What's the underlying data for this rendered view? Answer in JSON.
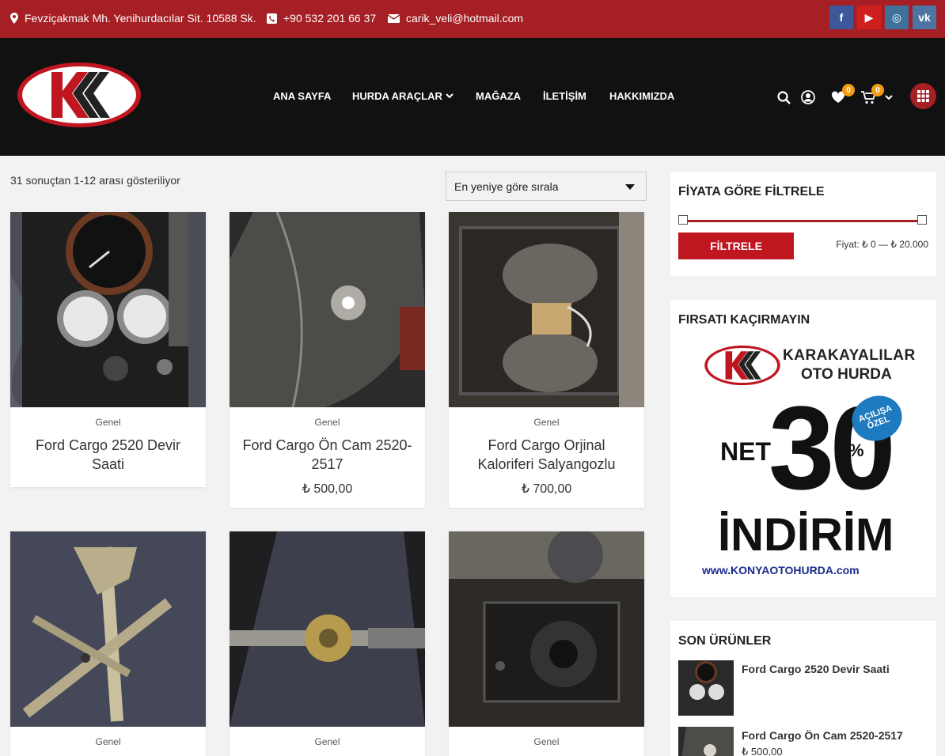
{
  "topbar": {
    "address": "Fevziçakmak Mh. Yenihurdacılar Sit. 10588 Sk.",
    "phone": "+90 532 201 66 37",
    "email": "carik_veli@hotmail.com",
    "social": [
      {
        "icon": "facebook-icon",
        "glyph": "f",
        "color": "#3b5998"
      },
      {
        "icon": "youtube-icon",
        "glyph": "▶",
        "color": "#cd201f"
      },
      {
        "icon": "instagram-icon",
        "glyph": "◎",
        "color": "#3f729b"
      },
      {
        "icon": "vk-icon",
        "glyph": "vk",
        "color": "#4c75a3"
      }
    ]
  },
  "header": {
    "logo_text": "KK",
    "nav": [
      {
        "label": "ANA SAYFA"
      },
      {
        "label": "HURDA ARAÇLAR",
        "dropdown": true
      },
      {
        "label": "MAĞAZA"
      },
      {
        "label": "İLETİŞİM"
      },
      {
        "label": "HAKKIMIZDA"
      }
    ],
    "wishlist_count": "0",
    "cart_count": "0"
  },
  "shop": {
    "result_count": "31 sonuçtan 1-12 arası gösteriliyor",
    "sort_selected": "En yeniye göre sırala",
    "products": [
      {
        "category": "Genel",
        "title": "Ford Cargo 2520 Devir Saati",
        "price": ""
      },
      {
        "category": "Genel",
        "title": "Ford Cargo Ön Cam 2520-2517",
        "price": "₺ 500,00"
      },
      {
        "category": "Genel",
        "title": "Ford Cargo Orjinal Kaloriferi Salyangozlu",
        "price": "₺ 700,00"
      },
      {
        "category": "Genel",
        "title": "",
        "price": ""
      },
      {
        "category": "Genel",
        "title": "",
        "price": ""
      },
      {
        "category": "Genel",
        "title": "",
        "price": ""
      }
    ]
  },
  "sidebar": {
    "price_filter": {
      "title": "FİYATA GÖRE FİLTRELE",
      "button": "FİLTRELE",
      "range": "Fiyat: ₺ 0 — ₺ 20.000"
    },
    "promo": {
      "title": "FIRSATI KAÇIRMAYIN",
      "brand_line1": "KARAKAYALILAR",
      "brand_line2": "OTO HURDA",
      "net": "NET",
      "percent_value": "30",
      "percent_sign": "%",
      "badge_line1": "AÇILIŞA",
      "badge_line2": "ÖZEL",
      "discount": "İNDİRİM",
      "url": "www.KONYAOTOHURDA.com"
    },
    "recent": {
      "title": "SON ÜRÜNLER",
      "items": [
        {
          "title": "Ford Cargo 2520 Devir Saati",
          "price": ""
        },
        {
          "title": "Ford Cargo Ön Cam 2520-2517",
          "price": "₺ 500,00"
        }
      ]
    }
  },
  "colors": {
    "brand_red": "#a51f24",
    "header_bg": "#111111",
    "badge_orange": "#f39c12"
  }
}
